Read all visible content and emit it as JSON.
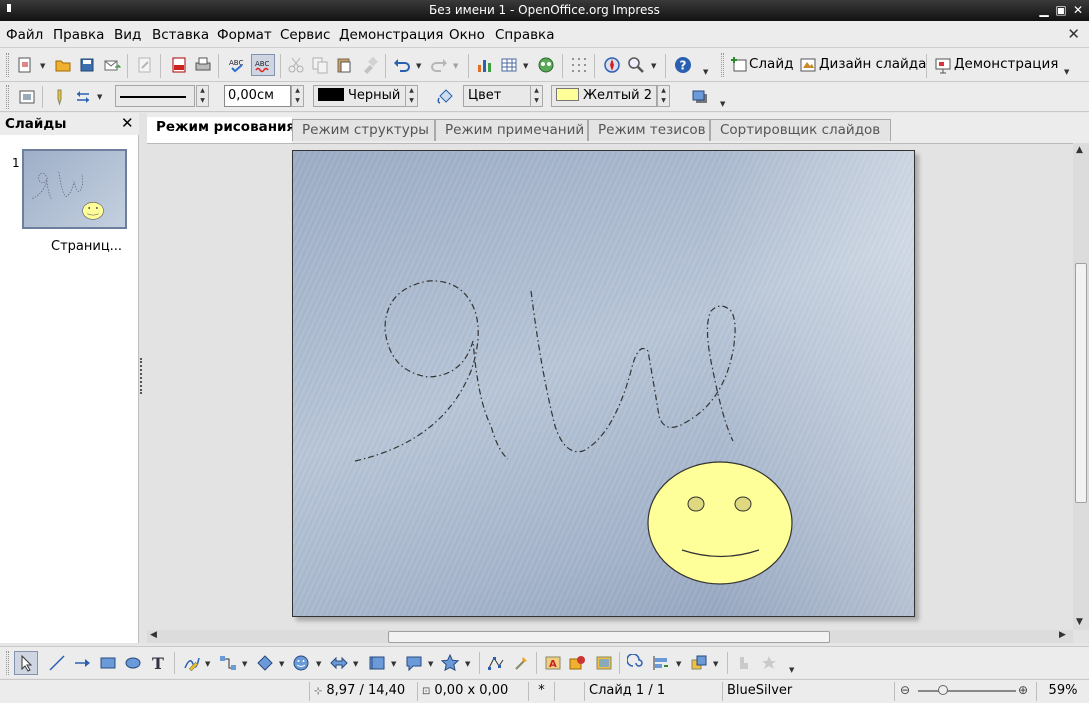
{
  "window": {
    "title": "Без имени 1 - OpenOffice.org Impress"
  },
  "menu": [
    "Файл",
    "Правка",
    "Вид",
    "Вставка",
    "Формат",
    "Сервис",
    "Демонстрация",
    "Окно",
    "Справка"
  ],
  "toolbar1": {
    "icons": [
      "new-document-icon",
      "open-folder-icon",
      "save-icon",
      "email-icon",
      "edit-file-icon",
      "export-pdf-icon",
      "print-icon",
      "spellcheck-icon",
      "autospellcheck-icon",
      "cut-icon",
      "copy-icon",
      "paste-icon",
      "format-paintbrush-icon",
      "undo-icon",
      "redo-icon",
      "chart-icon",
      "table-icon",
      "display-grid-icon",
      "grid-dots-icon",
      "navigator-icon",
      "zoom-icon",
      "help-icon"
    ],
    "slide_label": "Слайд",
    "design_label": "Дизайн слайда",
    "show_label": "Демонстрация"
  },
  "toolbar2": {
    "line_width": "0,00см",
    "line_color": "Черный",
    "area_type": "Цвет",
    "area_color": "Желтый 2",
    "line_color_hex": "#000000",
    "area_color_hex": "#ffff99"
  },
  "slides_pane": {
    "title": "Слайды",
    "thumb_number": "1",
    "thumb_label": "Страниц..."
  },
  "tabs": [
    "Режим рисования",
    "Режим структуры",
    "Режим примечаний",
    "Режим тезисов",
    "Сортировщик слайдов"
  ],
  "slide": {
    "theme_colors": {
      "background": "#a9b8cd",
      "smiley_fill": "#ffff99",
      "stroke": "#333333"
    }
  },
  "status": {
    "position": "8,97 / 14,40",
    "size": "0,00 x 0,00",
    "modified": "*",
    "slide": "Слайд 1 / 1",
    "design": "BlueSilver",
    "zoom": "59%"
  }
}
